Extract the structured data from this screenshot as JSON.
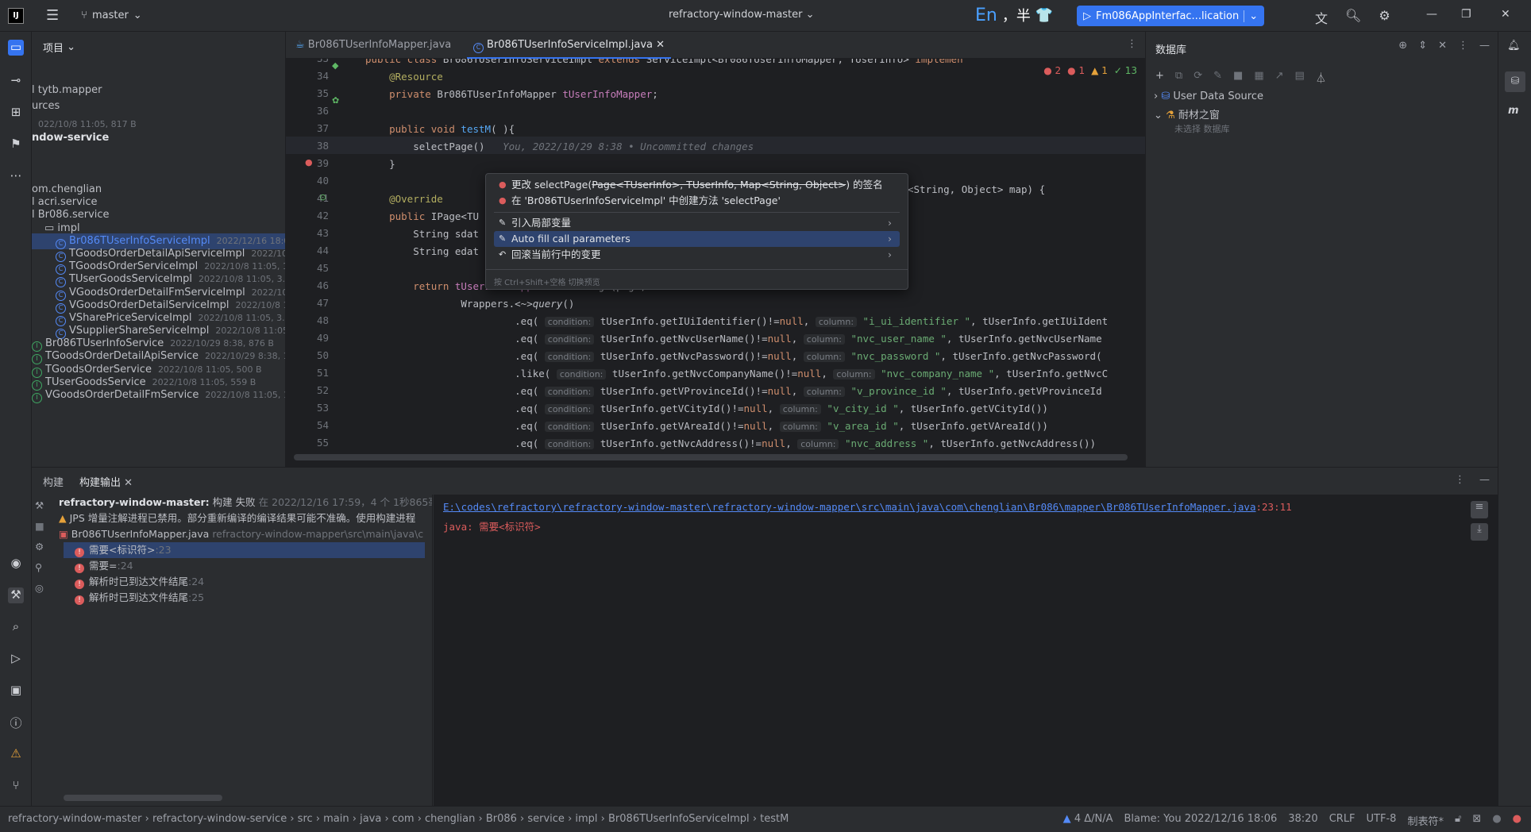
{
  "window": {
    "project_name": "refractory-window-master",
    "branch": "master",
    "ime_en": "En",
    "ime_rest": "，半",
    "run_config": "Fm086AppInterfac...lication",
    "min": "—",
    "max": "❐",
    "close": "✕"
  },
  "project": {
    "title": "项目",
    "rows": [
      {
        "text": "l tytb.mapper",
        "meta": ""
      },
      {
        "text": "urces",
        "meta": ""
      },
      {
        "text": "",
        "meta": "022/10/8 11:05, 817 B"
      },
      {
        "text": "ndow-service",
        "meta": ""
      },
      {
        "text": "om.chenglian",
        "meta": ""
      },
      {
        "text": "l acri.service",
        "meta": ""
      },
      {
        "text": "l Br086.service",
        "meta": ""
      },
      {
        "text": "impl",
        "meta": ""
      },
      {
        "text": "Br086TUserInfoServiceImpl",
        "meta": "2022/12/16 18:06,"
      },
      {
        "text": "TGoodsOrderDetailApiServiceImpl",
        "meta": "2022/10/2"
      },
      {
        "text": "TGoodsOrderServiceImpl",
        "meta": "2022/10/8 11:05, 1.5"
      },
      {
        "text": "TUserGoodsServiceImpl",
        "meta": "2022/10/8 11:05, 3.7 k"
      },
      {
        "text": "VGoodsOrderDetailFmServiceImpl",
        "meta": "2022/10/8"
      },
      {
        "text": "VGoodsOrderDetailServiceImpl",
        "meta": "2022/10/8 11:0"
      },
      {
        "text": "VSharePriceServiceImpl",
        "meta": "2022/10/8 11:05, 3.87"
      },
      {
        "text": "VSupplierShareServiceImpl",
        "meta": "2022/10/8 11:05, 1."
      },
      {
        "text": "Br086TUserInfoService",
        "meta": "2022/10/29 8:38, 876 B"
      },
      {
        "text": "TGoodsOrderDetailApiService",
        "meta": "2022/10/29 8:38, 1"
      },
      {
        "text": "TGoodsOrderService",
        "meta": "2022/10/8 11:05, 500 B"
      },
      {
        "text": "TUserGoodsService",
        "meta": "2022/10/8 11:05, 559 B"
      },
      {
        "text": "VGoodsOrderDetailFmService",
        "meta": "2022/10/8 11:05, 1."
      }
    ]
  },
  "tabs": [
    {
      "label": "Br086TUserInfoMapper.java"
    },
    {
      "label": "Br086TUserInfoServiceImpl.java"
    }
  ],
  "editor": {
    "inspect": {
      "errors": "2",
      "errors2": "1",
      "warnings": "1",
      "ok": "13"
    },
    "lines": [
      {
        "n": "33",
        "segs": [
          {
            "c": "kw",
            "t": "public class "
          },
          {
            "c": "",
            "t": "Br086TUserInfoServiceImpl "
          },
          {
            "c": "kw",
            "t": "extends "
          },
          {
            "c": "",
            "t": "ServiceImpl<Br086TUserInfoMapper, TUserInfo> "
          },
          {
            "c": "kw",
            "t": "implemen"
          }
        ]
      },
      {
        "n": "34",
        "segs": [
          {
            "c": "an",
            "t": "    @Resource"
          }
        ]
      },
      {
        "n": "35",
        "segs": [
          {
            "c": "kw",
            "t": "    private "
          },
          {
            "c": "",
            "t": "Br086TUserInfoMapper "
          },
          {
            "c": "fld",
            "t": "tUserInfoMapper"
          },
          {
            "c": "",
            "t": ";"
          }
        ]
      },
      {
        "n": "36",
        "segs": []
      },
      {
        "n": "37",
        "segs": [
          {
            "c": "kw",
            "t": "    public void "
          },
          {
            "c": "fn",
            "t": "testM"
          },
          {
            "c": "",
            "t": "( ){"
          }
        ]
      },
      {
        "n": "38",
        "segs": [
          {
            "c": "",
            "t": "        selectPage()"
          },
          {
            "c": "it",
            "t": "   You, 2022/10/29 8:38 • Uncommitted changes"
          }
        ]
      },
      {
        "n": "39",
        "segs": [
          {
            "c": "",
            "t": "    }"
          }
        ]
      },
      {
        "n": "40",
        "segs": []
      },
      {
        "n": "41",
        "segs": [
          {
            "c": "an",
            "t": "    @Override"
          }
        ]
      },
      {
        "n": "42",
        "segs": [
          {
            "c": "kw",
            "t": "    public "
          },
          {
            "c": "",
            "t": "IPage<TU"
          }
        ]
      },
      {
        "n": "43",
        "segs": [
          {
            "c": "",
            "t": "        String sdat"
          }
        ]
      },
      {
        "n": "44",
        "segs": [
          {
            "c": "",
            "t": "        String edat"
          }
        ]
      },
      {
        "n": "45",
        "segs": []
      },
      {
        "n": "46",
        "segs": [
          {
            "c": "kw",
            "t": "        return "
          },
          {
            "c": "fld",
            "t": "tUserInfoMapper"
          },
          {
            "c": "",
            "t": ".selectPage(page,"
          }
        ]
      },
      {
        "n": "47",
        "segs": [
          {
            "c": "",
            "t": "                Wrappers.<~>"
          },
          {
            "c": "it",
            "t": "query"
          },
          {
            "c": "",
            "t": "()"
          }
        ]
      },
      {
        "n": "48",
        "segs": [
          {
            "c": "",
            "t": "                         .eq( "
          },
          {
            "c": "hint",
            "t": "condition:"
          },
          {
            "c": "",
            "t": " tUserInfo.getIUiIdentifier()!="
          },
          {
            "c": "kw",
            "t": "null"
          },
          {
            "c": "",
            "t": ", "
          },
          {
            "c": "hint",
            "t": "column:"
          },
          {
            "c": "str",
            "t": " \"i_ui_identifier \""
          },
          {
            "c": "",
            "t": ", tUserInfo.getIUiIdent"
          }
        ]
      },
      {
        "n": "49",
        "segs": [
          {
            "c": "",
            "t": "                         .eq( "
          },
          {
            "c": "hint",
            "t": "condition:"
          },
          {
            "c": "",
            "t": " tUserInfo.getNvcUserName()!="
          },
          {
            "c": "kw",
            "t": "null"
          },
          {
            "c": "",
            "t": ", "
          },
          {
            "c": "hint",
            "t": "column:"
          },
          {
            "c": "str",
            "t": " \"nvc_user_name \""
          },
          {
            "c": "",
            "t": ", tUserInfo.getNvcUserName"
          }
        ]
      },
      {
        "n": "50",
        "segs": [
          {
            "c": "",
            "t": "                         .eq( "
          },
          {
            "c": "hint",
            "t": "condition:"
          },
          {
            "c": "",
            "t": " tUserInfo.getNvcPassword()!="
          },
          {
            "c": "kw",
            "t": "null"
          },
          {
            "c": "",
            "t": ", "
          },
          {
            "c": "hint",
            "t": "column:"
          },
          {
            "c": "str",
            "t": " \"nvc_password \""
          },
          {
            "c": "",
            "t": ", tUserInfo.getNvcPassword("
          }
        ]
      },
      {
        "n": "51",
        "segs": [
          {
            "c": "",
            "t": "                         .like( "
          },
          {
            "c": "hint",
            "t": "condition:"
          },
          {
            "c": "",
            "t": " tUserInfo.getNvcCompanyName()!="
          },
          {
            "c": "kw",
            "t": "null"
          },
          {
            "c": "",
            "t": ", "
          },
          {
            "c": "hint",
            "t": "column:"
          },
          {
            "c": "str",
            "t": " \"nvc_company_name \""
          },
          {
            "c": "",
            "t": ", tUserInfo.getNvcC"
          }
        ]
      },
      {
        "n": "52",
        "segs": [
          {
            "c": "",
            "t": "                         .eq( "
          },
          {
            "c": "hint",
            "t": "condition:"
          },
          {
            "c": "",
            "t": " tUserInfo.getVProvinceId()!="
          },
          {
            "c": "kw",
            "t": "null"
          },
          {
            "c": "",
            "t": ", "
          },
          {
            "c": "hint",
            "t": "column:"
          },
          {
            "c": "str",
            "t": " \"v_province_id \""
          },
          {
            "c": "",
            "t": ", tUserInfo.getVProvinceId"
          }
        ]
      },
      {
        "n": "53",
        "segs": [
          {
            "c": "",
            "t": "                         .eq( "
          },
          {
            "c": "hint",
            "t": "condition:"
          },
          {
            "c": "",
            "t": " tUserInfo.getVCityId()!="
          },
          {
            "c": "kw",
            "t": "null"
          },
          {
            "c": "",
            "t": ", "
          },
          {
            "c": "hint",
            "t": "column:"
          },
          {
            "c": "str",
            "t": " \"v_city_id \""
          },
          {
            "c": "",
            "t": ", tUserInfo.getVCityId())"
          }
        ]
      },
      {
        "n": "54",
        "segs": [
          {
            "c": "",
            "t": "                         .eq( "
          },
          {
            "c": "hint",
            "t": "condition:"
          },
          {
            "c": "",
            "t": " tUserInfo.getVAreaId()!="
          },
          {
            "c": "kw",
            "t": "null"
          },
          {
            "c": "",
            "t": ", "
          },
          {
            "c": "hint",
            "t": "column:"
          },
          {
            "c": "str",
            "t": " \"v_area_id \""
          },
          {
            "c": "",
            "t": ", tUserInfo.getVAreaId())"
          }
        ]
      },
      {
        "n": "55",
        "segs": [
          {
            "c": "",
            "t": "                         .eq( "
          },
          {
            "c": "hint",
            "t": "condition:"
          },
          {
            "c": "",
            "t": " tUserInfo.getNvcAddress()!="
          },
          {
            "c": "kw",
            "t": "null"
          },
          {
            "c": "",
            "t": ", "
          },
          {
            "c": "hint",
            "t": "column:"
          },
          {
            "c": "str",
            "t": " \"nvc_address \""
          },
          {
            "c": "",
            "t": ", tUserInfo.getNvcAddress())"
          }
        ]
      }
    ],
    "right_of_popup": "<String, Object> map) {"
  },
  "popup": {
    "item1_prefix": "更改 selectPage(",
    "item1_strike": "Page<TUserInfo>, TUserInfo, Map<String, Object>",
    "item1_suffix": ") 的签名",
    "item2": "在 'Br086TUserInfoServiceImpl' 中创建方法 'selectPage'",
    "item3": "引入局部变量",
    "item4": "Auto fill call parameters",
    "item5": "回滚当前行中的变更",
    "footer": "按 Ctrl+Shift+空格 切换预览"
  },
  "db": {
    "title": "数据库",
    "src1": "User Data Source",
    "src2": "耐材之窗",
    "src2_sub": "未选择 数据库"
  },
  "bottom": {
    "tab1": "构建",
    "tab2": "构建输出",
    "root_project": "refractory-window-master:",
    "root_status": "构建 失败",
    "root_time": "在 2022/12/16 17:59，4 个 1秒865毫秒",
    "jps_warning": "JPS 增量注解进程已禁用。部分重新编译的编译结果可能不准确。使用构建进程",
    "file_name": "Br086TUserInfoMapper.java",
    "file_path": "refractory-window-mapper\\src\\main\\java\\c",
    "errors": [
      {
        "msg": "需要<标识符>",
        "line": ":23"
      },
      {
        "msg": "需要=",
        "line": ":24"
      },
      {
        "msg": "解析时已到达文件结尾",
        "line": ":24"
      },
      {
        "msg": "解析时已到达文件结尾",
        "line": ":25"
      }
    ],
    "out_path": "E:\\codes\\refractory\\refractory-window-master\\refractory-window-mapper\\src\\main\\java\\com\\chenglian\\Br086\\mapper\\Br086TUserInfoMapper.java",
    "out_pos": ":23:11",
    "out_msg": "java: 需要<标识符>"
  },
  "status": {
    "crumbs": [
      "refractory-window-master",
      "refractory-window-service",
      "src",
      "main",
      "java",
      "com",
      "chenglian",
      "Br086",
      "service",
      "impl",
      "Br086TUserInfoServiceImpl",
      "testM"
    ],
    "vcs": "4 Δ/N/A",
    "blame": "Blame: You 2022/12/16 18:06",
    "pos": "38:20",
    "eol": "CRLF",
    "enc": "UTF-8",
    "indent": "制表符*"
  },
  "colors": {
    "accent": "#3574f0",
    "error": "#db5c5c",
    "bg": "#1e1f22",
    "panel": "#2b2d30"
  }
}
